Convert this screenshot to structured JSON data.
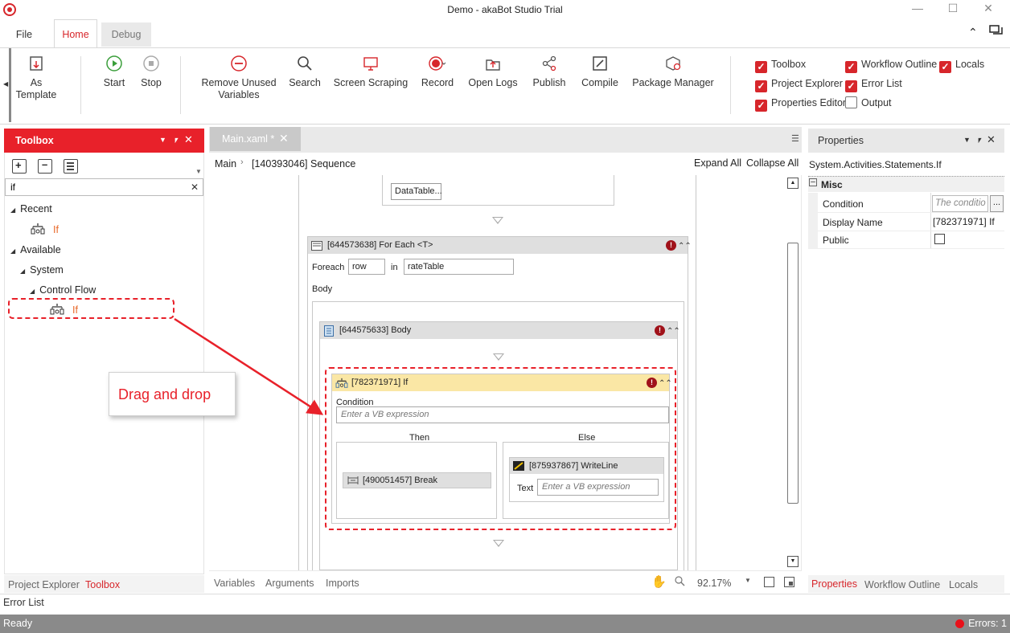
{
  "window": {
    "title": "Demo - akaBot Studio Trial"
  },
  "ribbon_tabs": {
    "file": "File",
    "home": "Home",
    "debug": "Debug"
  },
  "ribbon": {
    "as_template": "As Template",
    "start": "Start",
    "stop": "Stop",
    "remove_unused_1": "Remove Unused",
    "remove_unused_2": "Variables",
    "search": "Search",
    "screen_scraping": "Screen Scraping",
    "record": "Record",
    "open_logs": "Open Logs",
    "publish": "Publish",
    "compile": "Compile",
    "package_manager": "Package Manager"
  },
  "panel_toggles": [
    {
      "label": "Toolbox",
      "checked": true
    },
    {
      "label": "Workflow Outline",
      "checked": true
    },
    {
      "label": "Locals",
      "checked": true
    },
    {
      "label": "Project Explorer",
      "checked": true
    },
    {
      "label": "Error List",
      "checked": true
    },
    {
      "label": "Properties Editor",
      "checked": true
    },
    {
      "label": "Output",
      "checked": false
    }
  ],
  "toolbox": {
    "title": "Toolbox",
    "search_value": "if",
    "recent": "Recent",
    "recent_item": "If",
    "available": "Available",
    "system": "System",
    "control_flow": "Control Flow",
    "control_flow_item": "If"
  },
  "left_bottom_tabs": {
    "project_explorer": "Project Explorer",
    "toolbox": "Toolbox"
  },
  "error_list_label": "Error List",
  "callout": "Drag and drop",
  "document": {
    "tab": "Main.xaml *",
    "breadcrumb_main": "Main",
    "breadcrumb_seq": "[140393046] Sequence",
    "expand_all": "Expand All",
    "collapse_all": "Collapse All"
  },
  "designer": {
    "datatable_btn": "DataTable...",
    "foreach_title": "[644573638] For Each <T>",
    "foreach_label": "Foreach",
    "foreach_var": "row",
    "in_label": "in",
    "foreach_source": "rateTable",
    "body_label": "Body",
    "body_title": "[644575633] Body",
    "if_title": "[782371971] If",
    "condition_label": "Condition",
    "condition_placeholder": "Enter a VB expression",
    "then_label": "Then",
    "else_label": "Else",
    "break_title": "[490051457] Break",
    "writeline_title": "[875937867] WriteLine",
    "text_label": "Text",
    "text_placeholder": "Enter a VB expression"
  },
  "designer_bottom": {
    "variables": "Variables",
    "arguments": "Arguments",
    "imports": "Imports",
    "zoom": "92.17%"
  },
  "properties": {
    "title": "Properties",
    "type": "System.Activities.Statements.If",
    "category": "Misc",
    "rows": [
      {
        "name": "Condition",
        "value": "The conditio"
      },
      {
        "name": "Display Name",
        "value": "[782371971] If"
      },
      {
        "name": "Public",
        "value": ""
      }
    ]
  },
  "right_bottom_tabs": {
    "properties": "Properties",
    "workflow_outline": "Workflow Outline",
    "locals": "Locals"
  },
  "status": {
    "text": "Ready",
    "errors": "Errors: 1"
  },
  "colors": {
    "accent": "#e8212a",
    "orange": "#e8692a",
    "error_red": "#a0121a"
  }
}
